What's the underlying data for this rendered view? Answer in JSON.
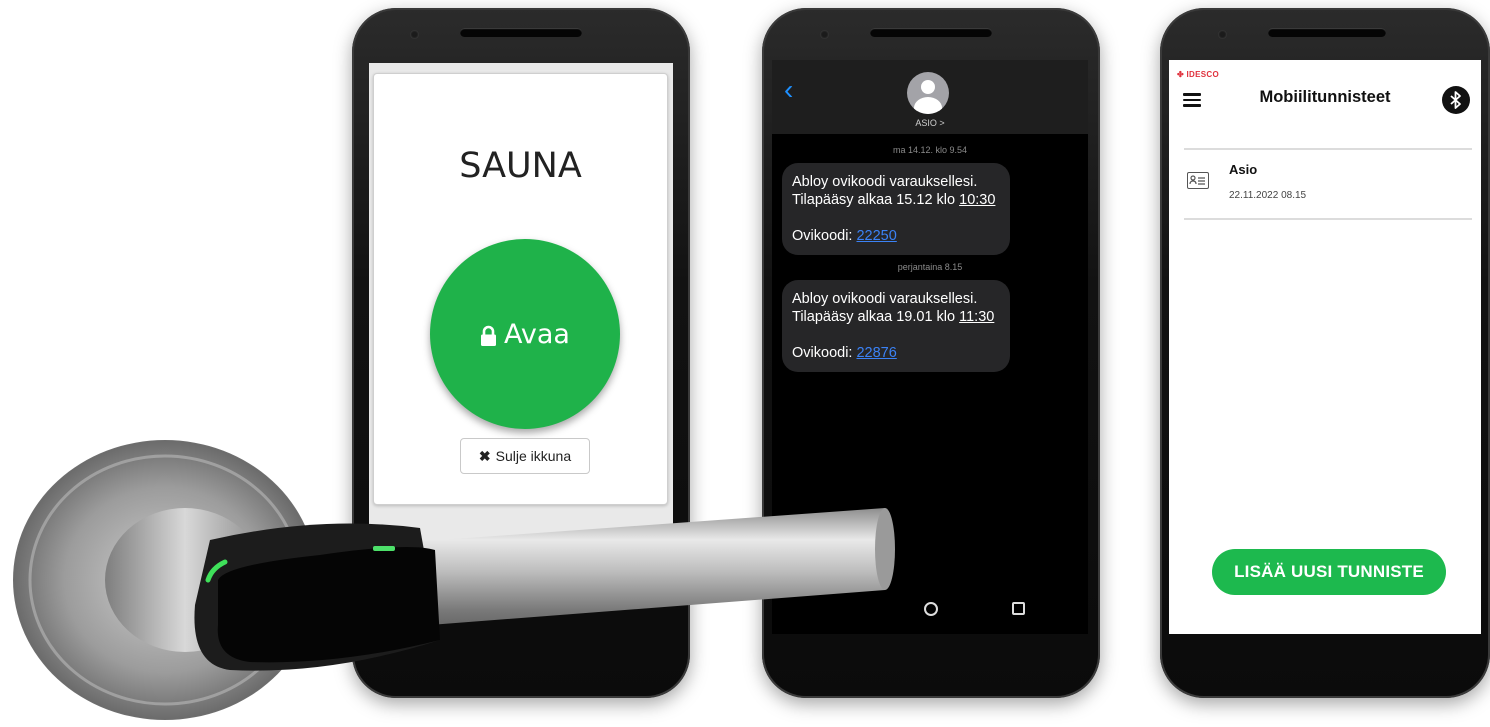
{
  "sauna_app": {
    "title": "SAUNA",
    "open_button": "Avaa",
    "close_button": "Sulje ikkuna",
    "accent": "#1fb24a"
  },
  "messages_app": {
    "contact": "ASIO >",
    "messages": [
      {
        "timestamp": "ma 14.12. klo 9.54",
        "line1": "Abloy ovikoodi varauksellesi.",
        "line2_prefix": "Tilapääsy alkaa 15.12 klo ",
        "time": "10:30",
        "code_label": "Ovikoodi: ",
        "code": "22250"
      },
      {
        "timestamp": "perjantaina 8.15",
        "line1": "Abloy ovikoodi varauksellesi.",
        "line2_prefix": "Tilapääsy alkaa 19.01 klo ",
        "time": "11:30",
        "code_label": "Ovikoodi: ",
        "code": "22876"
      }
    ]
  },
  "credentials_app": {
    "brand": "IDESCO",
    "title": "Mobiilitunnisteet",
    "credential": {
      "name": "Asio",
      "date": "22.11.2022 08.15"
    },
    "add_button": "LISÄÄ UUSI TUNNISTE",
    "accent": "#1db94e",
    "brand_color": "#e0313d"
  }
}
